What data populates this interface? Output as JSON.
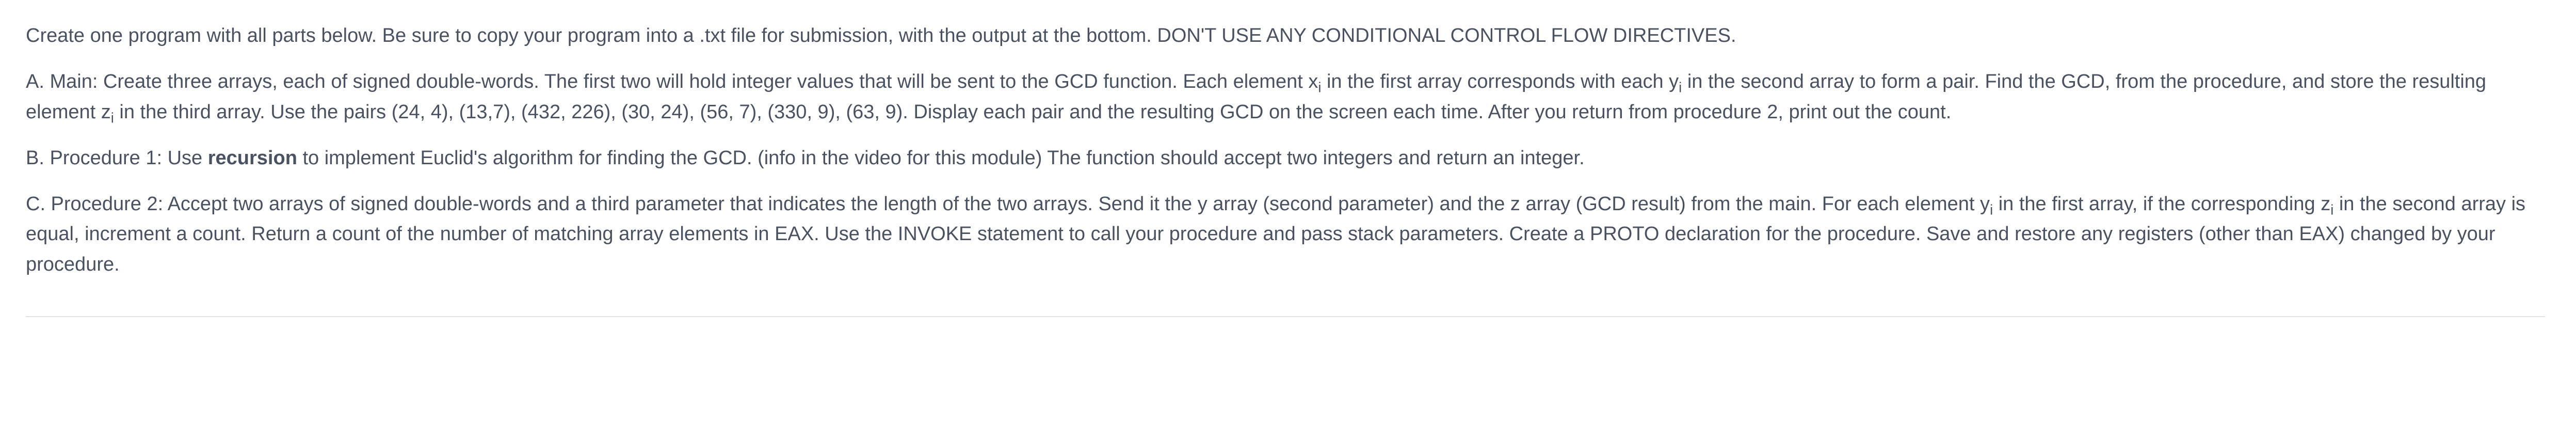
{
  "intro": {
    "text_a": "Create one program with all parts below.  Be sure to copy your program into a .txt file for submission, with the output at the bottom. DON'T USE ANY CONDITIONAL CONTROL FLOW DIRECTIVES."
  },
  "partA": {
    "lead": "A. Main:  Create three arrays, each of signed double-words.  The first two will hold integer values that will be sent to the GCD function.  Each element x",
    "sub1": "i",
    "mid1": " in the first array corresponds with each y",
    "sub2": "i",
    "mid2": " in the second array to form a pair. Find the GCD, from the procedure, and store the resulting element z",
    "sub3": "i",
    "tail": " in the third array. Use the pairs (24, 4), (13,7), (432, 226), (30, 24), (56, 7), (330, 9), (63, 9).  Display each pair and the resulting GCD on the screen each time. After you return from procedure 2, print out the count."
  },
  "partB": {
    "lead": "B. Procedure 1: Use ",
    "bold": "recursion",
    "tail": " to implement Euclid's algorithm for finding the GCD. (info in the video for this module) The function should accept two integers and return an integer."
  },
  "partC": {
    "lead": "C. Procedure 2: Accept two arrays of signed double-words and a third parameter that indicates the length of the two arrays.  Send it the y array (second parameter) and the z array (GCD result) from the main.  For each element y",
    "sub1": "i",
    "mid1": " in the first array, if the corresponding z",
    "sub2": "i",
    "tail": " in the second array is equal, increment a count.  Return a count of the number of matching array elements in EAX. Use the INVOKE statement to call your procedure and pass stack parameters.  Create a PROTO declaration for the procedure.  Save and restore any registers (other than EAX) changed by your procedure."
  }
}
